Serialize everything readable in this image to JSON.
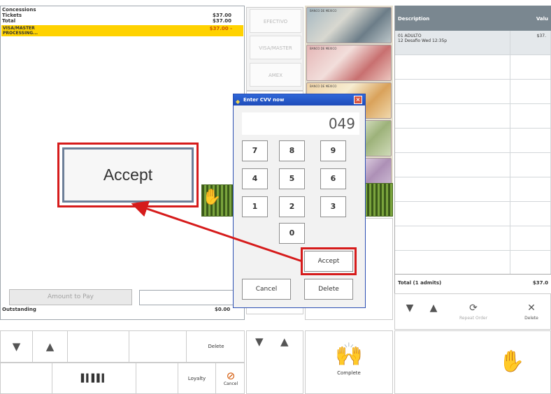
{
  "summary": {
    "rows": [
      {
        "label": "Concessions",
        "value": ""
      },
      {
        "label": "Tickets",
        "value": "$37.00"
      },
      {
        "label": "Total",
        "value": "$37.00"
      }
    ],
    "payment": {
      "method": "VISA/MASTER",
      "status": "PROCESSING...",
      "value": "$37.00 -"
    },
    "amount_button": "Amount to Pay",
    "outstanding_label": "Outstanding",
    "outstanding_value": "$0.00"
  },
  "callout": {
    "label": "Accept"
  },
  "payment_buttons": [
    "EFECTIVO",
    "VISA/MASTER",
    "AMEX"
  ],
  "bills": [
    "BANCO DE MEXICO",
    "BANCO DE MEXICO",
    "BANCO DE MEXICO"
  ],
  "order": {
    "header": {
      "description": "Description",
      "value": "Valu"
    },
    "item": {
      "name": "01 ADULTO",
      "detail": "12 Desafio Wed 12:35p",
      "price": "$37."
    },
    "total_label": "Total (1 admits)",
    "total_value": "$37.0"
  },
  "right_actions": {
    "repeat_label": "Repeat Order",
    "delete_label": "Delete"
  },
  "bottom_bar": {
    "delete_label": "Delete",
    "loyalty_label": "Loyalty",
    "cancel_label": "Cancel"
  },
  "complete_label": "Complete",
  "dialog": {
    "title": "Enter CVV now",
    "display_value": "049",
    "keys": [
      "7",
      "8",
      "9",
      "4",
      "5",
      "6",
      "1",
      "2",
      "3",
      "0"
    ],
    "accept_label": "Accept",
    "cancel_label": "Cancel",
    "delete_label": "Delete"
  },
  "colors": {
    "highlight": "#ffd200",
    "callout_red": "#d61b1b",
    "dialog_title": "#1f4cb9",
    "header_grey": "#7a8790"
  },
  "icons": [
    "down-arrow-icon",
    "up-arrow-icon",
    "barcode-icon",
    "cancel-icon",
    "hand-icon",
    "repeat-icon",
    "delete-icon",
    "cursor-icon"
  ]
}
